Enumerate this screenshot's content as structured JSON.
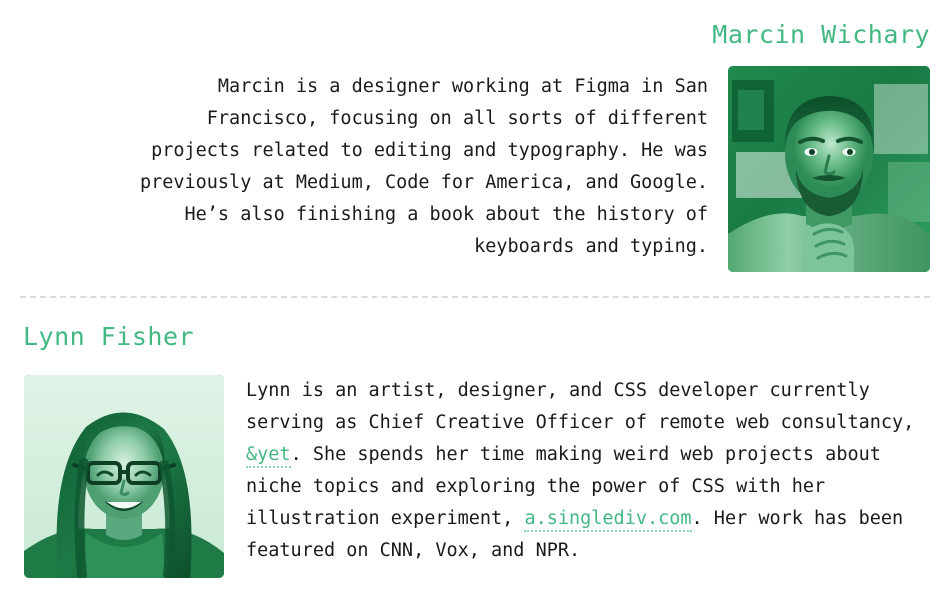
{
  "page": {
    "accent_green": "#43b883",
    "text_color": "#1b1b1b",
    "divider_color": "#dcdcdc",
    "background": "#ffffff"
  },
  "bios": [
    {
      "id": "marcin",
      "name": "Marcin Wichary",
      "align": "right",
      "photo_alt": "Marcin Wichary portrait",
      "bio_parts": {
        "text": "Marcin is a designer working at Figma in San Francisco, focusing on all sorts of different projects related to editing and typography. He was previously at Medium, Code for America, and Google. He’s also finishing a book about the history of keyboards and typing."
      }
    },
    {
      "id": "lynn",
      "name": "Lynn Fisher",
      "align": "left",
      "photo_alt": "Lynn Fisher portrait",
      "bio_parts": {
        "before_link1": "Lynn is an artist, designer, and CSS developer currently serving as Chief Creative Officer of remote web consultancy, ",
        "link1": "&yet",
        "between_links": ". She spends her time making weird web projects about niche topics and exploring the power of CSS with her illustration experiment, ",
        "link2": "a.singlediv.com",
        "after_link2": ". Her work has been featured on CNN, Vox, and NPR."
      }
    }
  ]
}
